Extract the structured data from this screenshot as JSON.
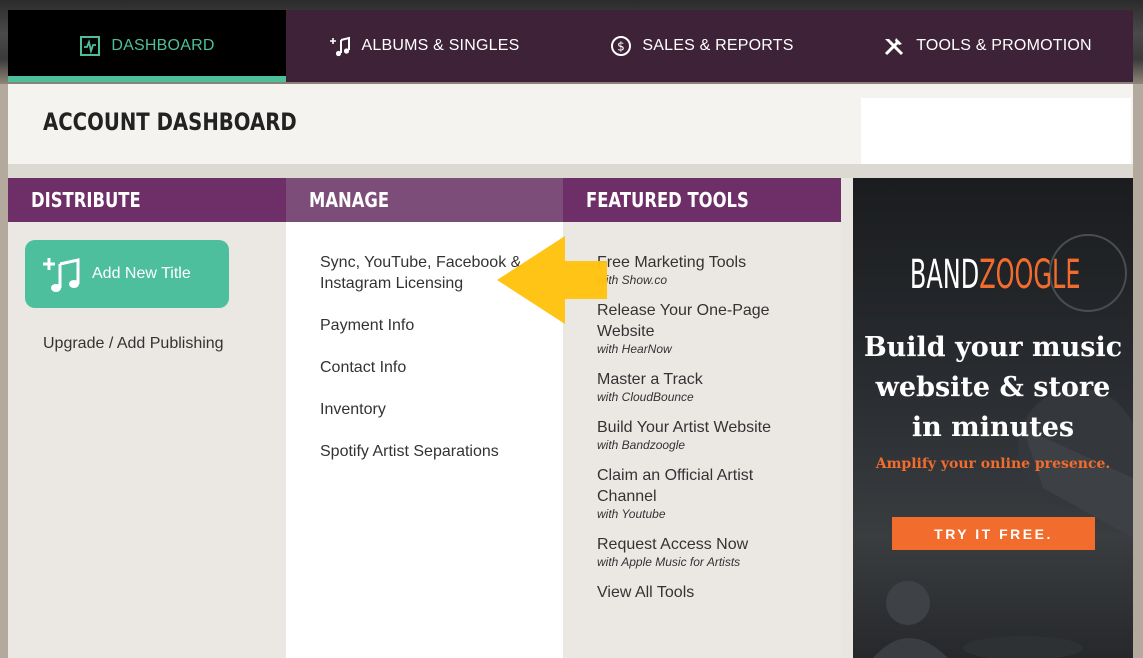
{
  "nav": {
    "tabs": [
      {
        "label": "DASHBOARD",
        "icon": "pulse-icon"
      },
      {
        "label": "ALBUMS & SINGLES",
        "icon": "music-notes-icon"
      },
      {
        "label": "SALES & REPORTS",
        "icon": "dollar-circle-icon"
      },
      {
        "label": "TOOLS & PROMOTION",
        "icon": "tools-icon"
      }
    ],
    "active": "DASHBOARD",
    "accent_color": "#4dbf9c"
  },
  "header": {
    "title": "ACCOUNT DASHBOARD"
  },
  "distribute": {
    "heading": "DISTRIBUTE",
    "add_button": "Add New Title",
    "upgrade_link": "Upgrade / Add Publishing"
  },
  "manage": {
    "heading": "MANAGE",
    "items": [
      "Sync, YouTube, Facebook & Instagram Licensing",
      "Payment Info",
      "Contact Info",
      "Inventory",
      "Spotify Artist Separations"
    ]
  },
  "featured": {
    "heading": "FEATURED TOOLS",
    "items": [
      {
        "title": "Free Marketing Tools",
        "sub": "with Show.co"
      },
      {
        "title": "Release Your One-Page Website",
        "sub": "with HearNow"
      },
      {
        "title": "Master a Track",
        "sub": "with CloudBounce"
      },
      {
        "title": "Build Your Artist Website",
        "sub": "with Bandzoogle"
      },
      {
        "title": "Claim an Official Artist Channel",
        "sub": "with Youtube"
      },
      {
        "title": "Request Access Now",
        "sub": "with Apple Music for Artists"
      }
    ],
    "view_all": "View All Tools"
  },
  "ad": {
    "logo_part1": "BAND",
    "logo_part2": "ZOOGLE",
    "headline": "Build your music website & store in minutes",
    "subline": "Amplify your online presence.",
    "cta": "TRY IT FREE.",
    "accent_color": "#f26d2d"
  },
  "colors": {
    "purple_header": "#6e2f69",
    "purple_light": "#7d4d79",
    "green": "#4dbf9c",
    "arrow_yellow": "#ffc20e"
  }
}
